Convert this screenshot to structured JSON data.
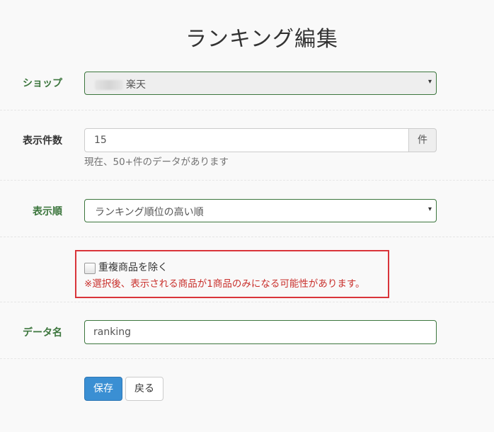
{
  "page": {
    "title": "ランキング編集"
  },
  "form": {
    "shop": {
      "label": "ショップ",
      "value": "楽天"
    },
    "count": {
      "label": "表示件数",
      "value": "15",
      "unit": "件",
      "help": "現在、50+件のデータがあります"
    },
    "order": {
      "label": "表示順",
      "value": "ランキング順位の高い順"
    },
    "dedupe": {
      "label": "重複商品を除く",
      "checked": false,
      "warning": "※選択後、表示される商品が1商品のみになる可能性があります。"
    },
    "data_name": {
      "label": "データ名",
      "value": "ranking"
    }
  },
  "buttons": {
    "save": "保存",
    "back": "戻る"
  },
  "colors": {
    "success_green": "#3c763d",
    "primary_blue": "#3a8fd3",
    "warning_red": "#d9353a"
  },
  "icons": {
    "select_caret": "▾"
  }
}
